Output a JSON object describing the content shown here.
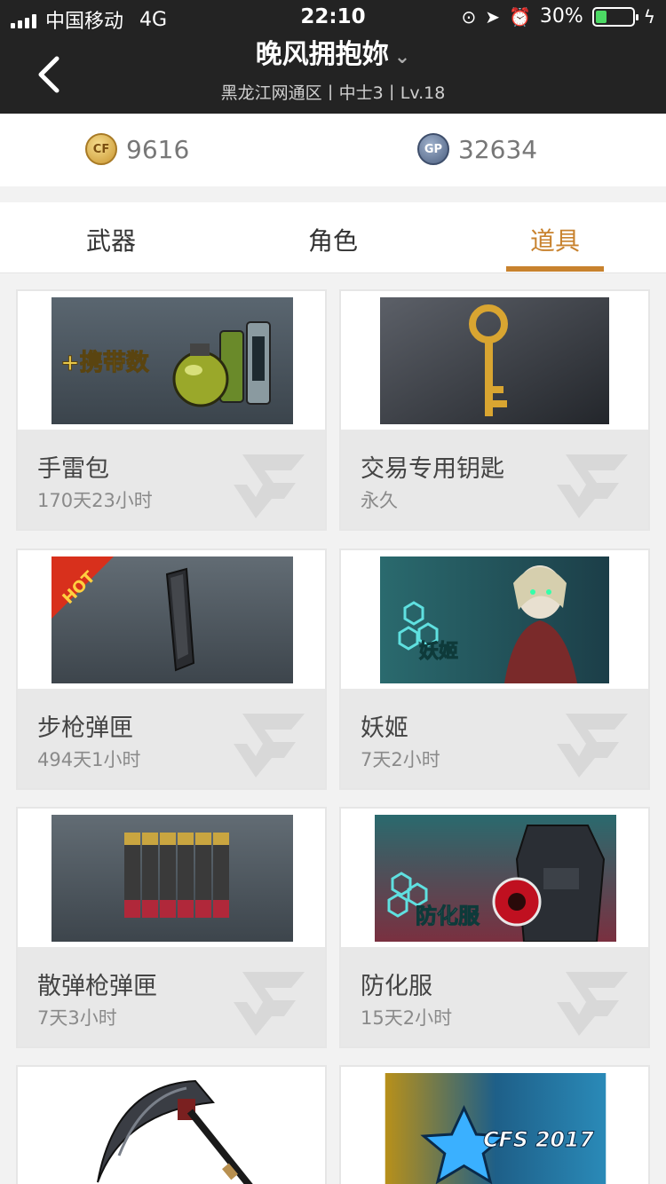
{
  "status_bar": {
    "carrier": "中国移动",
    "network": "4G",
    "time": "22:10",
    "battery": "30%",
    "battery_level": 0.3
  },
  "header": {
    "title": "晚风拥抱妳",
    "subtitle": "黑龙江网通区丨中士3丨Lv.18"
  },
  "currency": {
    "cf_points": "9616",
    "gp_points": "32634",
    "cf_icon": "CF",
    "gp_icon": "GP"
  },
  "tabs": [
    {
      "label": "武器",
      "active": false
    },
    {
      "label": "角色",
      "active": false
    },
    {
      "label": "道具",
      "active": true
    }
  ],
  "items": [
    {
      "name": "手雷包",
      "duration": "170天23小时",
      "overlay_text": "+携带数"
    },
    {
      "name": "交易专用钥匙",
      "duration": "永久"
    },
    {
      "name": "步枪弹匣",
      "duration": "494天1小时",
      "badge": "HOT"
    },
    {
      "name": "妖姬",
      "duration": "7天2小时",
      "overlay_text": "妖姬"
    },
    {
      "name": "散弹枪弹匣",
      "duration": "7天3小时"
    },
    {
      "name": "防化服",
      "duration": "15天2小时",
      "overlay_text": "防化服"
    },
    {
      "name": "",
      "duration": ""
    },
    {
      "name": "",
      "duration": "",
      "overlay_text": "CFS 2017"
    }
  ],
  "colors": {
    "accent": "#c8822e",
    "header_bg": "#232323"
  }
}
